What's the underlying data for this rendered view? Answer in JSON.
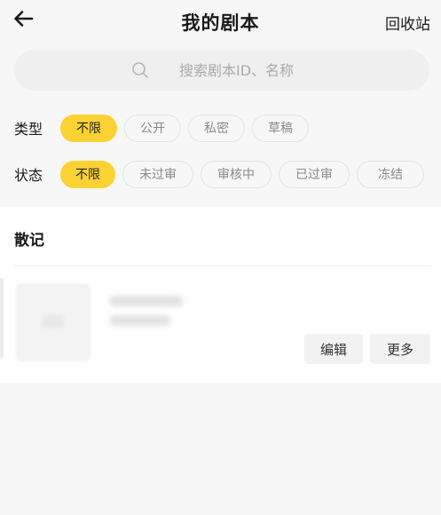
{
  "header": {
    "title": "我的剧本",
    "recycle_label": "回收站"
  },
  "search": {
    "placeholder": "搜索剧本ID、名称"
  },
  "filters": {
    "type_label": "类型",
    "type_options": [
      "不限",
      "公开",
      "私密",
      "草稿"
    ],
    "type_selected": "不限",
    "status_label": "状态",
    "status_options": [
      "不限",
      "未过审",
      "审核中",
      "已过审",
      "冻结"
    ],
    "status_selected": "不限"
  },
  "section": {
    "title": "散记"
  },
  "card": {
    "edit_label": "编辑",
    "more_label": "更多"
  },
  "colors": {
    "accent": "#fbd233",
    "background": "#f7f7f7"
  }
}
